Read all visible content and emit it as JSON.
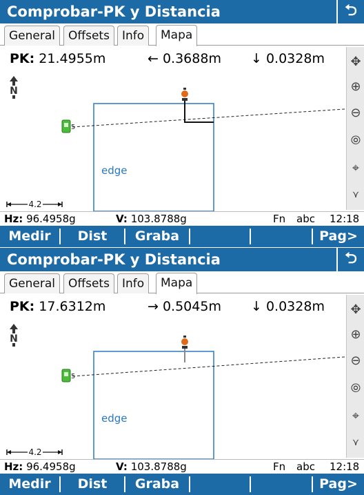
{
  "screens": [
    {
      "title": "Comprobar-PK y Distancia",
      "back_icon": "return-arrow-icon",
      "tabs": [
        "General",
        "Offsets",
        "Info",
        "Mapa"
      ],
      "active_tab": "Mapa",
      "pk_label": "PK:",
      "pk_value": "21.4955m",
      "offset_value": "← 0.3688m",
      "height_value": "↓ 0.0328m",
      "north_label": "N",
      "edge_label": "edge",
      "scale_label": "4.2",
      "hz_label": "Hz:",
      "hz_value": "96.4958g",
      "v_label": "V:",
      "v_value": "103.8788g",
      "fn_label": "Fn",
      "abc_label": "abc",
      "time": "12:18",
      "softkeys": [
        "Medir",
        "Dist",
        "Graba",
        "",
        "",
        "Pag>"
      ]
    },
    {
      "title": "Comprobar-PK y Distancia",
      "back_icon": "return-arrow-icon",
      "tabs": [
        "General",
        "Offsets",
        "Info",
        "Mapa"
      ],
      "active_tab": "Mapa",
      "pk_label": "PK:",
      "pk_value": "17.6312m",
      "offset_value": "→ 0.5045m",
      "height_value": "↓ 0.0328m",
      "north_label": "N",
      "edge_label": "edge",
      "scale_label": "4.2",
      "hz_label": "Hz:",
      "hz_value": "96.4958g",
      "v_label": "V:",
      "v_value": "103.8788g",
      "fn_label": "Fn",
      "abc_label": "abc",
      "time": "12:18",
      "softkeys": [
        "Medir",
        "Dist",
        "Graba",
        "",
        "",
        "Pag>"
      ]
    }
  ],
  "colors": {
    "title_bar": "#1c6aa6",
    "map_line": "#2a78c2",
    "instrument": "#4cbb3a",
    "prism": "#e06a1a"
  },
  "toolbar_icons": [
    "pan-icon",
    "zoom-in-icon",
    "zoom-out-icon",
    "zoom-extents-icon",
    "center-target-icon",
    "chevron-down-icon"
  ]
}
